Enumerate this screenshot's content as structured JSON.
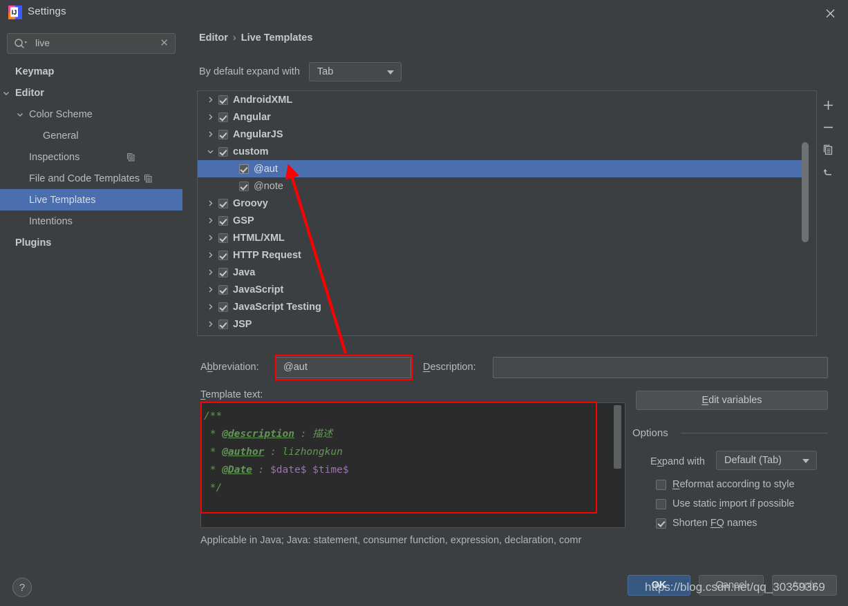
{
  "window": {
    "title": "Settings",
    "logo_icon": "intellij-idea-logo",
    "close_icon": "close-icon"
  },
  "sidebar": {
    "search": {
      "value": "live",
      "placeholder": "",
      "search_icon": "search-icon",
      "clear_icon": "clear-icon"
    },
    "items": [
      {
        "label": "Keymap",
        "indent": 0,
        "bold": true,
        "arrow": "",
        "selected": false,
        "badge": false
      },
      {
        "label": "Editor",
        "indent": 0,
        "bold": true,
        "arrow": "down",
        "selected": false,
        "badge": false
      },
      {
        "label": "Color Scheme",
        "indent": 1,
        "bold": false,
        "arrow": "down",
        "selected": false,
        "badge": false
      },
      {
        "label": "General",
        "indent": 2,
        "bold": false,
        "arrow": "",
        "selected": false,
        "badge": false
      },
      {
        "label": "Inspections",
        "indent": 1,
        "bold": false,
        "arrow": "",
        "selected": false,
        "badge": true
      },
      {
        "label": "File and Code Templates",
        "indent": 1,
        "bold": false,
        "arrow": "",
        "selected": false,
        "badge": true
      },
      {
        "label": "Live Templates",
        "indent": 1,
        "bold": false,
        "arrow": "",
        "selected": true,
        "badge": false
      },
      {
        "label": "Intentions",
        "indent": 1,
        "bold": false,
        "arrow": "",
        "selected": false,
        "badge": false
      },
      {
        "label": "Plugins",
        "indent": 0,
        "bold": true,
        "arrow": "",
        "selected": false,
        "badge": false
      }
    ]
  },
  "main": {
    "breadcrumb": {
      "root": "Editor",
      "separator": "›",
      "leaf": "Live Templates"
    },
    "expand_row": {
      "label": "By default expand with",
      "value": "Tab",
      "caret_icon": "chevron-down-icon"
    },
    "tree": {
      "rows": [
        {
          "label": "AndroidXML",
          "level": 0,
          "twisty": "right",
          "checked": true,
          "selected": false
        },
        {
          "label": "Angular",
          "level": 0,
          "twisty": "right",
          "checked": true,
          "selected": false
        },
        {
          "label": "AngularJS",
          "level": 0,
          "twisty": "right",
          "checked": true,
          "selected": false
        },
        {
          "label": "custom",
          "level": 0,
          "twisty": "down",
          "checked": true,
          "selected": false
        },
        {
          "label": "@aut",
          "level": 1,
          "twisty": "none",
          "checked": true,
          "selected": true
        },
        {
          "label": "@note",
          "level": 1,
          "twisty": "none",
          "checked": true,
          "selected": false
        },
        {
          "label": "Groovy",
          "level": 0,
          "twisty": "right",
          "checked": true,
          "selected": false
        },
        {
          "label": "GSP",
          "level": 0,
          "twisty": "right",
          "checked": true,
          "selected": false
        },
        {
          "label": "HTML/XML",
          "level": 0,
          "twisty": "right",
          "checked": true,
          "selected": false
        },
        {
          "label": "HTTP Request",
          "level": 0,
          "twisty": "right",
          "checked": true,
          "selected": false
        },
        {
          "label": "Java",
          "level": 0,
          "twisty": "right",
          "checked": true,
          "selected": false
        },
        {
          "label": "JavaScript",
          "level": 0,
          "twisty": "right",
          "checked": true,
          "selected": false
        },
        {
          "label": "JavaScript Testing",
          "level": 0,
          "twisty": "right",
          "checked": true,
          "selected": false
        },
        {
          "label": "JSP",
          "level": 0,
          "twisty": "right",
          "checked": true,
          "selected": false
        }
      ],
      "toolbar": [
        {
          "icon": "add-icon",
          "glyph": "+"
        },
        {
          "icon": "remove-icon",
          "glyph": "−"
        },
        {
          "icon": "duplicate-icon",
          "glyph": ""
        },
        {
          "icon": "revert-icon",
          "glyph": ""
        }
      ]
    },
    "abbreviation": {
      "label": "Abbreviation:",
      "mnemonic": "b",
      "value": "@aut"
    },
    "description": {
      "label": "Description:",
      "mnemonic": "D",
      "value": ""
    },
    "template_text": {
      "label": "Template text:",
      "mnemonic": "T",
      "lines": [
        [
          {
            "t": "/**",
            "c": "com"
          }
        ],
        [
          {
            "t": " * ",
            "c": "com"
          },
          {
            "t": "@description",
            "c": "tag"
          },
          {
            "t": " : 描述",
            "c": "com"
          }
        ],
        [
          {
            "t": " * ",
            "c": "com"
          },
          {
            "t": "@author",
            "c": "tag"
          },
          {
            "t": " : lizhongkun",
            "c": "com"
          }
        ],
        [
          {
            "t": " * ",
            "c": "com"
          },
          {
            "t": "@Date",
            "c": "tag"
          },
          {
            "t": " : ",
            "c": "com"
          },
          {
            "t": "$date$ $time$",
            "c": "var"
          }
        ],
        [
          {
            "t": " */",
            "c": "com"
          }
        ]
      ]
    },
    "applicable": "Applicable in Java; Java: statement, consumer function, expression, declaration, comr"
  },
  "options": {
    "edit_variables_label": "Edit variables",
    "edit_variables_mnemonic": "E",
    "title": "Options",
    "expand_with": {
      "label": "Expand with",
      "mnemonic": "x",
      "value": "Default (Tab)",
      "caret_icon": "chevron-down-icon"
    },
    "checkboxes": [
      {
        "label_pre": "",
        "mnemonic": "R",
        "label_post": "eformat according to style",
        "checked": false
      },
      {
        "label_pre": "Use static ",
        "mnemonic": "i",
        "label_post": "mport if possible",
        "checked": false
      },
      {
        "label_pre": "Shorten ",
        "mnemonic": "FQ",
        "label_post": " names",
        "checked": true
      }
    ]
  },
  "bottom": {
    "help_icon": "help-icon",
    "ok_label": "OK",
    "cancel_label": "Cancel",
    "apply_label": "Apply"
  },
  "annotation": {
    "watermark": "https://blog.csdn.net/qq_30359369",
    "color": "#fe0000"
  },
  "colors": {
    "window_bg": "#3c3f41",
    "selection_blue": "#4b6eaf",
    "editor_bg": "#2b2b2b",
    "code_comment": "#629755",
    "code_variable": "#9876aa",
    "ok_button": "#365880",
    "annotation_red": "#fe0000"
  }
}
